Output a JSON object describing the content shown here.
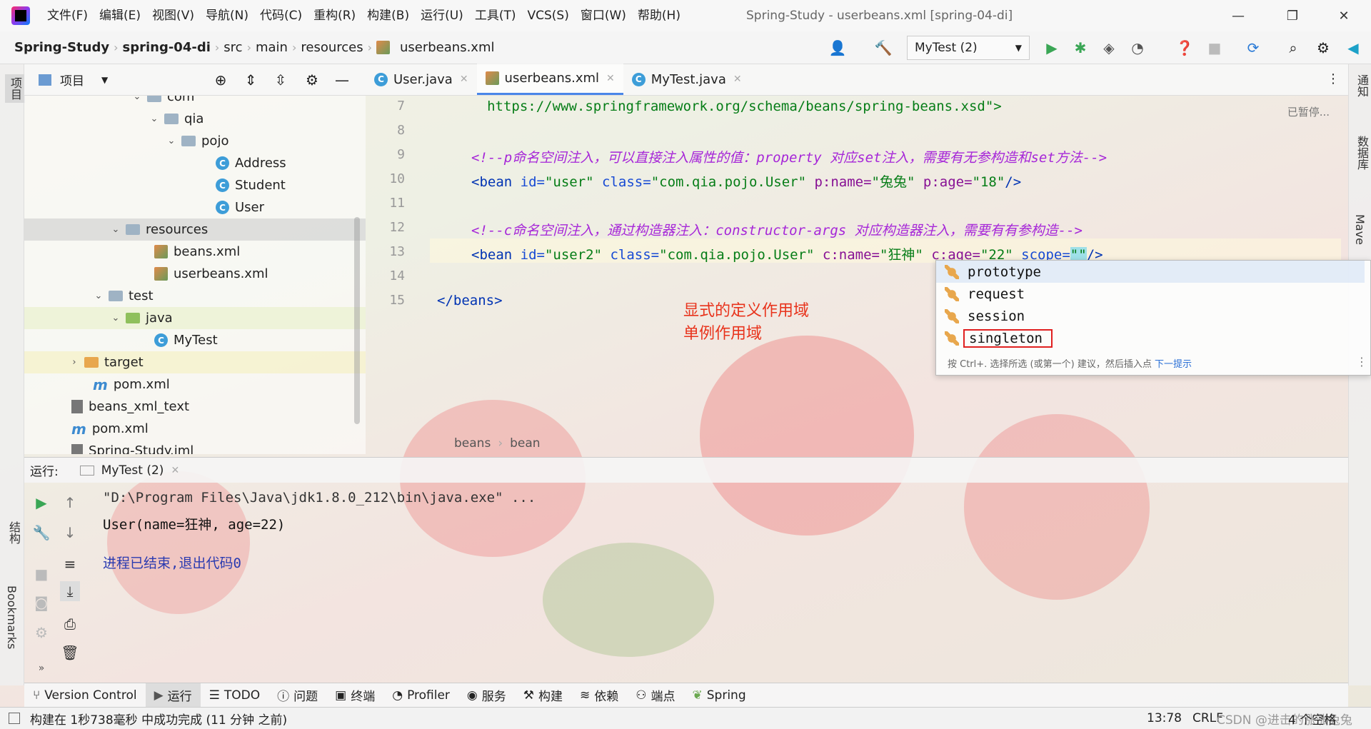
{
  "menu": [
    "文件(F)",
    "编辑(E)",
    "视图(V)",
    "导航(N)",
    "代码(C)",
    "重构(R)",
    "构建(B)",
    "运行(U)",
    "工具(T)",
    "VCS(S)",
    "窗口(W)",
    "帮助(H)"
  ],
  "window_title": "Spring-Study - userbeans.xml [spring-04-di]",
  "window_controls": {
    "minimize": "—",
    "restore": "❐",
    "close": "✕"
  },
  "breadcrumb": [
    "Spring-Study",
    "spring-04-di",
    "src",
    "main",
    "resources",
    "userbeans.xml"
  ],
  "run_config": "MyTest (2)",
  "left_strip": {
    "project": "项目",
    "structure": "结构",
    "bookmarks": "Bookmarks"
  },
  "right_strip": {
    "notifications": "通知",
    "database": "数据库",
    "maven": "Mave"
  },
  "project_panel": {
    "title": "项目",
    "tree": [
      {
        "label": "com",
        "type": "folder",
        "arrow": "⌄"
      },
      {
        "label": "qia",
        "type": "folder",
        "arrow": "⌄"
      },
      {
        "label": "pojo",
        "type": "folder",
        "arrow": "⌄"
      },
      {
        "label": "Address",
        "type": "class"
      },
      {
        "label": "Student",
        "type": "class"
      },
      {
        "label": "User",
        "type": "class"
      },
      {
        "label": "resources",
        "type": "folder",
        "arrow": "⌄"
      },
      {
        "label": "beans.xml",
        "type": "xml"
      },
      {
        "label": "userbeans.xml",
        "type": "xml"
      },
      {
        "label": "test",
        "type": "folder",
        "arrow": "⌄"
      },
      {
        "label": "java",
        "type": "folder-green",
        "arrow": "⌄"
      },
      {
        "label": "MyTest",
        "type": "class"
      },
      {
        "label": "target",
        "type": "folder-orange",
        "arrow": "›"
      },
      {
        "label": "pom.xml",
        "type": "maven"
      },
      {
        "label": "beans_xml_text",
        "type": "text"
      },
      {
        "label": "pom.xml",
        "type": "maven"
      },
      {
        "label": "Spring-Study.iml",
        "type": "text"
      }
    ]
  },
  "tabs": [
    {
      "label": "User.java",
      "close": "✕"
    },
    {
      "label": "userbeans.xml",
      "close": "✕"
    },
    {
      "label": "MyTest.java",
      "close": "✕"
    }
  ],
  "editor": {
    "paused_label": "已暂停...",
    "line_numbers": [
      "7",
      "8",
      "9",
      "10",
      "11",
      "12",
      "13",
      "14",
      "15"
    ],
    "line7": "       https://www.springframework.org/schema/beans/spring-beans.xsd\">",
    "line9": "<!--p命名空间注入，可以直接注入属性的值：property 对应set注入，需要有无参构造和set方法-->",
    "line10": {
      "a": "<bean ",
      "b": "id=",
      "c": "\"user\" ",
      "d": "class=",
      "e": "\"com.qia.pojo.User\" ",
      "f": "p:name=",
      "g": "\"兔兔\" ",
      "h": "p:age=",
      "i": "\"18\"",
      "j": "/>"
    },
    "line12": "<!--c命名空间注入，通过构造器注入：constructor-args 对应构造器注入，需要有有参构造-->",
    "line13": {
      "a": "<bean ",
      "b": "id=",
      "c": "\"user2\" ",
      "d": "class=",
      "e": "\"com.qia.pojo.User\" ",
      "f": "c:name=",
      "g": "\"狂神\" ",
      "h": "c:age=",
      "i": "\"22\" ",
      "j": "scope=",
      "k": "\"\"",
      "l": "/>"
    },
    "line15": "</beans>",
    "breadcrumb": [
      "beans",
      "bean"
    ]
  },
  "completion": {
    "items": [
      "prototype",
      "request",
      "session",
      "singleton"
    ],
    "hint": "按 Ctrl+. 选择所选 (或第一个) 建议，然后插入点 ",
    "hint_link": "下一提示"
  },
  "annotation": [
    "显式的定义作用域",
    "单例作用域"
  ],
  "run_panel": {
    "label": "运行:",
    "tab": "MyTest (2)",
    "console": [
      "\"D:\\Program Files\\Java\\jdk1.8.0_212\\bin\\java.exe\" ...",
      "User(name=狂神, age=22)",
      "",
      "进程已结束,退出代码0"
    ]
  },
  "bottom_tools": [
    "Version Control",
    "运行",
    "TODO",
    "问题",
    "终端",
    "Profiler",
    "服务",
    "构建",
    "依赖",
    "端点",
    "Spring"
  ],
  "status": {
    "message": "构建在 1秒738毫秒 中成功完成 (11 分钟 之前)",
    "position": "13:78",
    "line_sep": "CRLF",
    "watermark": "CSDN @进击的涨涨兔兔",
    "indent": "4 个空格"
  },
  "colors": {
    "accent": "#4a86e8",
    "annotation": "#e8331c",
    "highlight_box": "#e02020"
  }
}
